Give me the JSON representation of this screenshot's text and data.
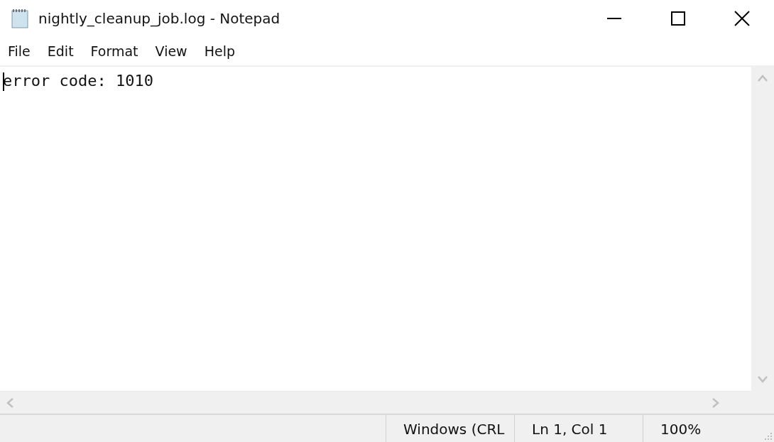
{
  "window": {
    "title": "nightly_cleanup_job.log - Notepad"
  },
  "menu": [
    "File",
    "Edit",
    "Format",
    "View",
    "Help"
  ],
  "editor": {
    "text": "error code: 1010"
  },
  "status_bar": [
    "Windows (CRL",
    "Ln 1, Col 1",
    "100%"
  ]
}
